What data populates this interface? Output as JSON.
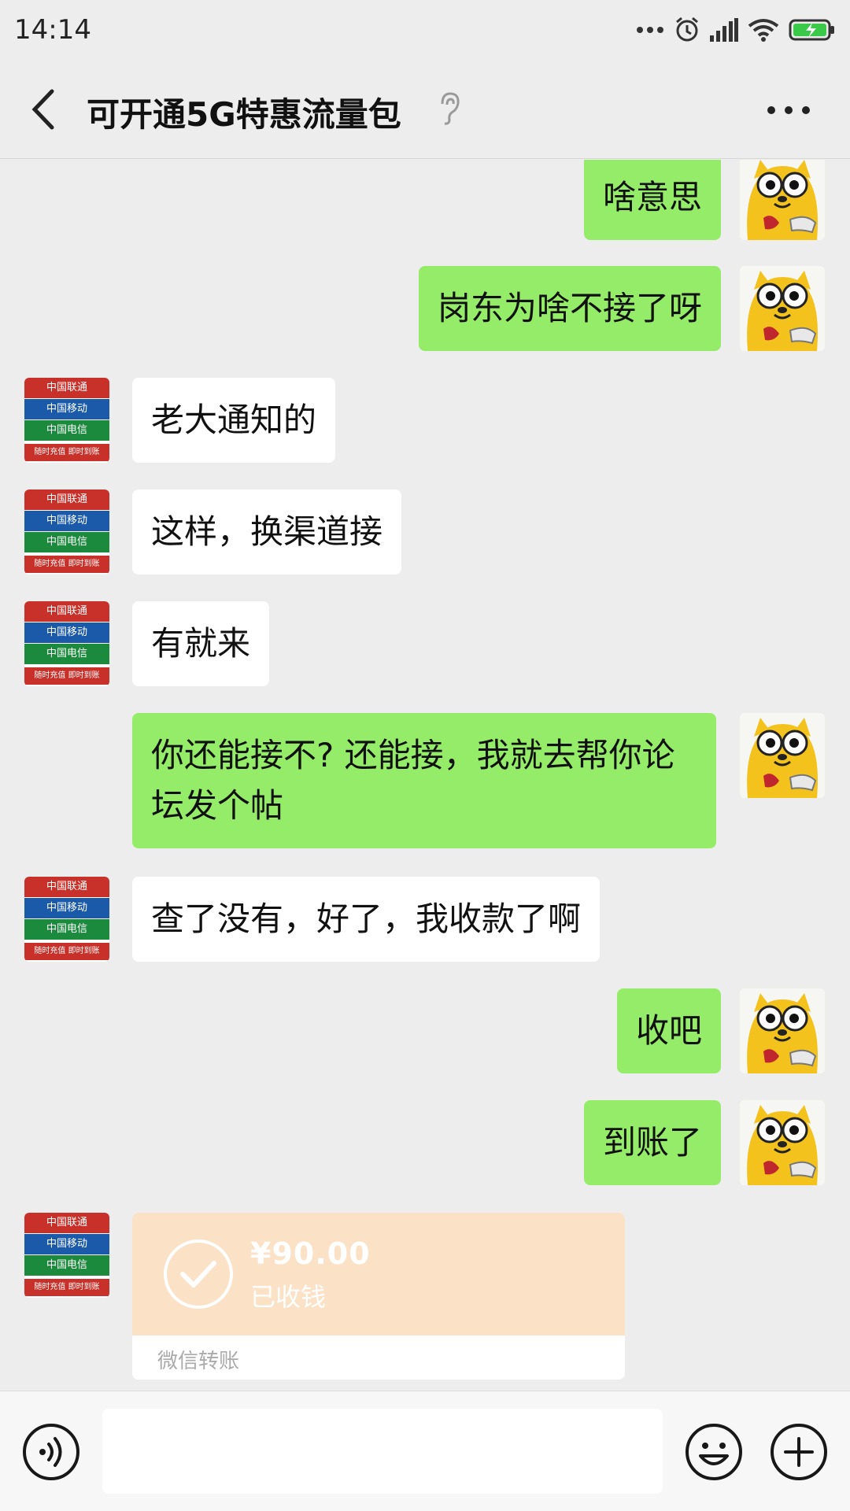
{
  "status_bar": {
    "time": "14:14"
  },
  "header": {
    "title": "可开通5G特惠流量包"
  },
  "messages": [
    {
      "side": "out",
      "text": "啥意思"
    },
    {
      "side": "out",
      "text": "岗东为啥不接了呀"
    },
    {
      "side": "in",
      "text": "老大通知的"
    },
    {
      "side": "in",
      "text": "这样，换渠道接"
    },
    {
      "side": "in",
      "text": "有就来"
    },
    {
      "side": "out",
      "text": "你还能接不? 还能接，我就去帮你论坛发个帖"
    },
    {
      "side": "in",
      "text": "查了没有，好了，我收款了啊"
    },
    {
      "side": "out",
      "text": "收吧"
    },
    {
      "side": "out",
      "text": "到账了"
    }
  ],
  "transfer": {
    "amount": "¥90.00",
    "status": "已收钱",
    "label": "微信转账"
  },
  "telco_avatar": {
    "lines": [
      "中国联通",
      "中国移动",
      "中国电信",
      "随时充值 即时到账"
    ]
  },
  "icons": {
    "back": "chevron-left-icon",
    "ear": "ear-icon",
    "more": "more-dots-icon",
    "voice": "voice-icon",
    "emoji": "emoji-icon",
    "plus": "plus-icon"
  },
  "colors": {
    "outgoing_bubble": "#95ec69",
    "incoming_bubble": "#ffffff",
    "background": "#ededed",
    "transfer_card": "#fbe1c6"
  }
}
